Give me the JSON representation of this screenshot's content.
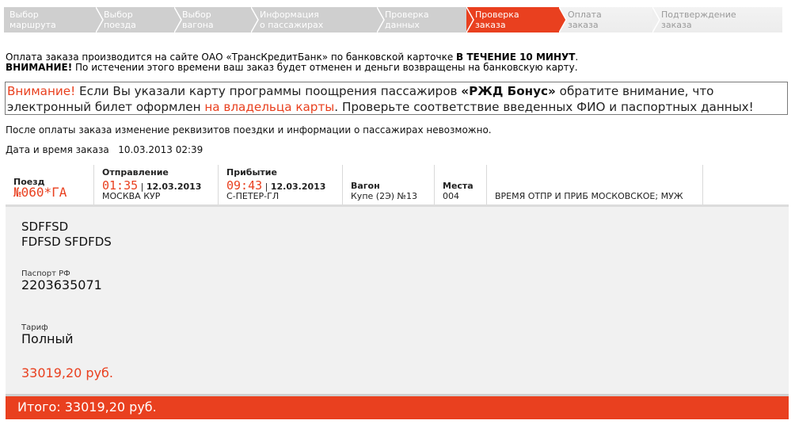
{
  "stepper": {
    "steps": [
      {
        "line1": "Выбор",
        "line2": "маршрута",
        "state": "done"
      },
      {
        "line1": "Выбор",
        "line2": "поезда",
        "state": "done"
      },
      {
        "line1": "Выбор",
        "line2": "вагона",
        "state": "done"
      },
      {
        "line1": "Информация",
        "line2": "о пассажирах",
        "state": "done"
      },
      {
        "line1": "Проверка",
        "line2": "данных",
        "state": "done"
      },
      {
        "line1": "Проверка",
        "line2": "заказа",
        "state": "active"
      },
      {
        "line1": "Оплата",
        "line2": "заказа",
        "state": "todo"
      },
      {
        "line1": "Подтверждение",
        "line2": "заказа",
        "state": "todo"
      }
    ]
  },
  "payment_info": {
    "line1_text": "Оплата заказа производится на сайте ОАО «ТрансКредитБанк» по банковской карточке ",
    "line1_bold": "В ТЕЧЕНИЕ 10 МИНУТ",
    "line1_end": ".",
    "line2_bold": "ВНИМАНИЕ!",
    "line2_text": " По истечении этого времени ваш заказ будет отменен и деньги возвращены на банковскую карту."
  },
  "warning": {
    "attention": "Внимание!",
    "text1": " Если Вы указали карту программы поощрения пассажиров ",
    "bonus": "«РЖД Бонус»",
    "text2": " обратите внимание, что электронный билет оформлен ",
    "owner": "на владельца карты",
    "text3": ". Проверьте соответствие введенных ФИО и паспортных данных!"
  },
  "notice": "После оплаты заказа изменение реквизитов поездки и информации о пассажирах невозможно.",
  "order_date": {
    "label": "Дата и время заказа",
    "value": "10.03.2013 02:39"
  },
  "train": {
    "train_label": "Поезд",
    "train_number": "№060*ГА",
    "departure_label": "Отправление",
    "departure_time": "01:35",
    "departure_date": "12.03.2013",
    "departure_station": "МОСКВА КУР",
    "arrival_label": "Прибытие",
    "arrival_time": "09:43",
    "arrival_date": "12.03.2013",
    "arrival_station": "С-ПЕТЕР-ГЛ",
    "car_label": "Вагон",
    "car_value": "Купе (2Э) №13",
    "seats_label": "Места",
    "seats_value": "004",
    "note": "ВРЕМЯ ОТПР И ПРИБ МОСКОВСКОЕ; МУЖ"
  },
  "passenger": {
    "last_name": "SDFFSD",
    "first_names": "FDFSD SFDFDS",
    "doc_label": "Паспорт РФ",
    "doc_number": "2203635071",
    "tariff_label": "Тариф",
    "tariff_value": "Полный",
    "price": "33019,20 руб."
  },
  "total": "Итого: 33019,20 руб.",
  "colors": {
    "accent": "#e9401f",
    "step_done": "#cfcfcf",
    "step_todo": "#efefef",
    "panel": "#f1f1f1"
  }
}
